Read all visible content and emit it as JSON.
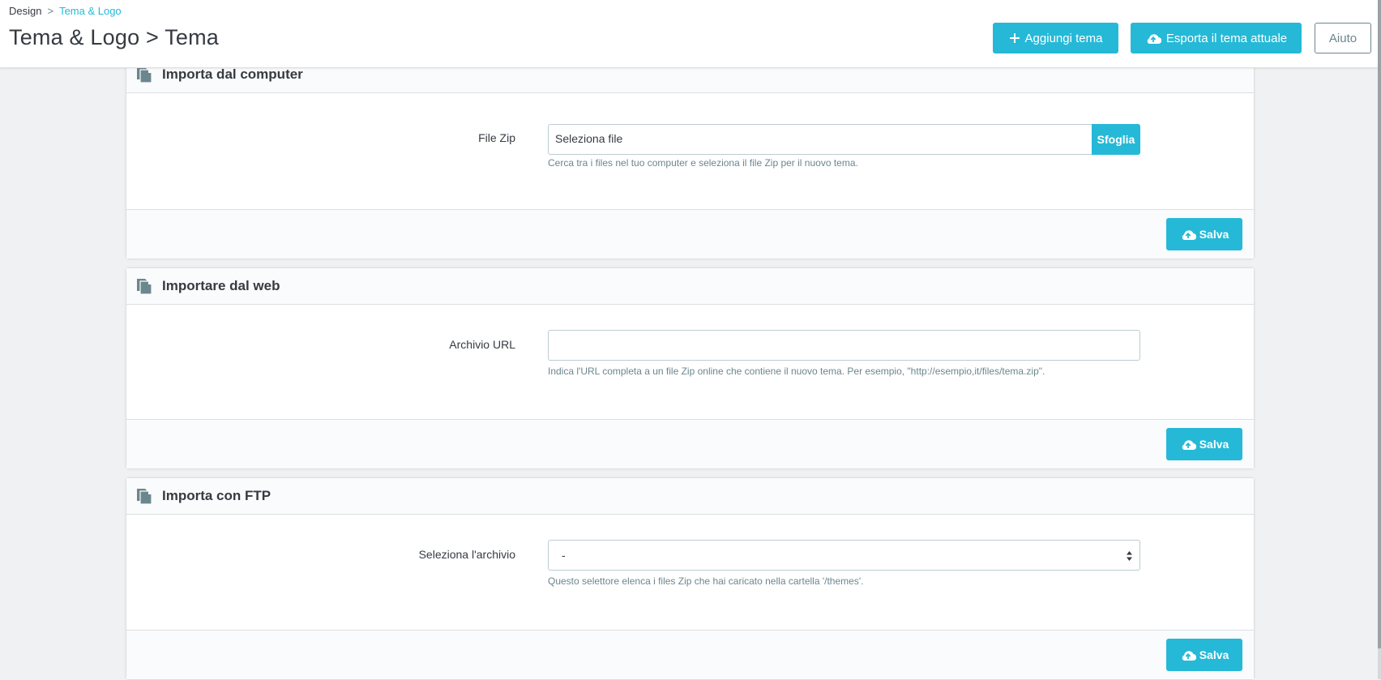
{
  "breadcrumb": {
    "parent": "Design",
    "separator": ">",
    "current": "Tema & Logo"
  },
  "page_title": "Tema & Logo > Tema",
  "toolbar": {
    "add_theme": "Aggiungi tema",
    "export_theme": "Esporta il tema attuale",
    "help": "Aiuto"
  },
  "panels": {
    "computer": {
      "title": "Importa dal computer",
      "field_label": "File Zip",
      "file_placeholder": "Seleziona file",
      "browse": "Sfoglia",
      "help": "Cerca tra i files nel tuo computer e seleziona il file Zip per il nuovo tema.",
      "save": "Salva"
    },
    "web": {
      "title": "Importare dal web",
      "field_label": "Archivio URL",
      "value": "",
      "help": "Indica l'URL completa a un file Zip online che contiene il nuovo tema. Per esempio, \"http://esempio,it/files/tema.zip\".",
      "save": "Salva"
    },
    "ftp": {
      "title": "Importa con FTP",
      "field_label": "Seleziona l'archivio",
      "selected": "-",
      "help": "Questo selettore elenca i files Zip che hai caricato nella cartella '/themes'.",
      "save": "Salva"
    }
  },
  "icons": {
    "panel_heading": "copy-icon",
    "add": "plus-icon",
    "export": "cloud-upload-icon",
    "save": "cloud-upload-icon",
    "select": "sort-arrows-icon"
  },
  "colors": {
    "accent": "#25b9d7",
    "text": "#363a41",
    "muted": "#6c868e",
    "background": "#eff1f2"
  }
}
